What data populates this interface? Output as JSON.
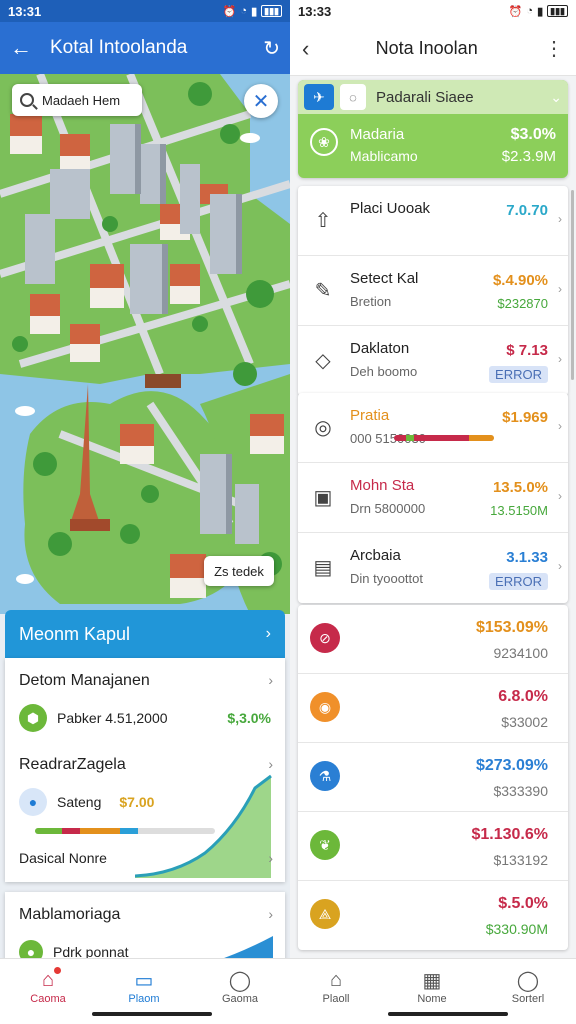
{
  "left": {
    "status_time": "13:31",
    "appbar_title": "Kotal Intoolanda",
    "search_placeholder": "Madaeh Hem",
    "map_chip": "Zs tedek",
    "panel_header": "Meonm Kapul",
    "card1": {
      "title": "Detom Manajanen",
      "row1_label": "Pabker 4.51,2000",
      "row1_value": "$,3.0%",
      "section_title": "ReadrarZagela",
      "row2_label": "Sateng",
      "row2_value": "$7.00",
      "footer_label": "Dasical Nonre"
    },
    "card2": {
      "title": "Mablamoriaga",
      "row_label": "Pdrk ponnat"
    }
  },
  "right": {
    "status_time": "13:33",
    "appbar_title": "Nota Inoolan",
    "featured": {
      "tab_label": "Padarali Siaee",
      "name": "Madaria",
      "sub": "Mablicamo",
      "value1": "$3.0%",
      "value2": "$2.3.9M"
    },
    "group1": [
      {
        "icon": "rocket-icon",
        "glyph": "⇧",
        "title": "Placi Uooak",
        "sub": "",
        "value1": "7.0.70",
        "value1_color": "#2aa8c9",
        "value2": "",
        "value2_color": "#2aa8c9",
        "pill": ""
      },
      {
        "icon": "tools-icon",
        "glyph": "✎",
        "title": "Setect Kal",
        "sub": "Bretion",
        "value1": "$.4.90%",
        "value1_color": "#e3901c",
        "value2": "$232870",
        "value2_color": "#47a83c",
        "pill": ""
      },
      {
        "icon": "diamond-icon",
        "glyph": "◇",
        "title": "Daklaton",
        "sub": "Deh boomo",
        "value1": "$ 7.13",
        "value1_color": "#c62a4a",
        "value2": "",
        "value2_color": "#c62a4a",
        "pill": "ERROR"
      }
    ],
    "group2": [
      {
        "icon": "globe-icon",
        "glyph": "◎",
        "title": "Pratia",
        "sub": "000 5150030",
        "title_color": "#e3901c",
        "value1": "$1.969",
        "value1_color": "#e3901c",
        "value2": "",
        "value2_color": "#e3901c",
        "pill": "",
        "bar": [
          0.12,
          0.08,
          0.55,
          0.25
        ]
      },
      {
        "icon": "layers-icon",
        "glyph": "▣",
        "title": "Mohn Sta",
        "sub": "Drn 5800000",
        "title_color": "#c62a4a",
        "value1": "13.5.0%",
        "value1_color": "#e3901c",
        "value2": "13.5150M",
        "value2_color": "#47a83c",
        "pill": ""
      },
      {
        "icon": "chart-icon",
        "glyph": "▤",
        "title": "Arcbaia",
        "sub": "Din tyooottot",
        "title_color": "#222",
        "value1": "3.1.33",
        "value1_color": "#2a7fd4",
        "value2": "",
        "value2_color": "#2a7fd4",
        "pill": "ERROR"
      }
    ],
    "group3": [
      {
        "icon": "compass-icon",
        "glyph": "⊘",
        "circle_color": "#c62a4a",
        "value1": "$153.09%",
        "value1_color": "#e3901c",
        "value2": "9234100"
      },
      {
        "icon": "sun-icon",
        "glyph": "◉",
        "circle_color": "#f0902a",
        "value1": "6.8.0%",
        "value1_color": "#c62a4a",
        "value2": "$33002"
      },
      {
        "icon": "flask-icon",
        "glyph": "⚗",
        "circle_color": "#2a7fd4",
        "value1": "$273.09%",
        "value1_color": "#2a7fd4",
        "value2": "$333390"
      },
      {
        "icon": "leaf-icon",
        "glyph": "❦",
        "circle_color": "#6cb83a",
        "value1": "$1.130.6%",
        "value1_color": "#c62a4a",
        "value2": "$133192"
      },
      {
        "icon": "gem-icon",
        "glyph": "⟁",
        "circle_color": "#d9a320",
        "value1": "$.5.0%",
        "value1_color": "#c62a4a",
        "value2": "$330.90M",
        "value2_color": "#47a83c"
      }
    ]
  },
  "nav": [
    {
      "label": "Caoma",
      "icon": "home-icon",
      "glyph": "⌂",
      "active": false,
      "dot": true
    },
    {
      "label": "Plaom",
      "icon": "briefcase-icon",
      "glyph": "▭",
      "active": true,
      "dot": false
    },
    {
      "label": "Gaoma",
      "icon": "profile-icon",
      "glyph": "◯",
      "active": false,
      "dot": false
    },
    {
      "label": "Plaoll",
      "icon": "home-icon",
      "glyph": "⌂",
      "active": false,
      "dot": false
    },
    {
      "label": "Nome",
      "icon": "inbox-icon",
      "glyph": "▦",
      "active": false,
      "dot": false
    },
    {
      "label": "Sorterl",
      "icon": "profile-icon",
      "glyph": "◯",
      "active": false,
      "dot": false
    }
  ],
  "colors": {
    "primary": "#2a6fd2",
    "accent_green": "#8ccf5a",
    "accent_blue": "#2196d8",
    "error_red": "#c62a4a",
    "orange": "#e3901c"
  }
}
